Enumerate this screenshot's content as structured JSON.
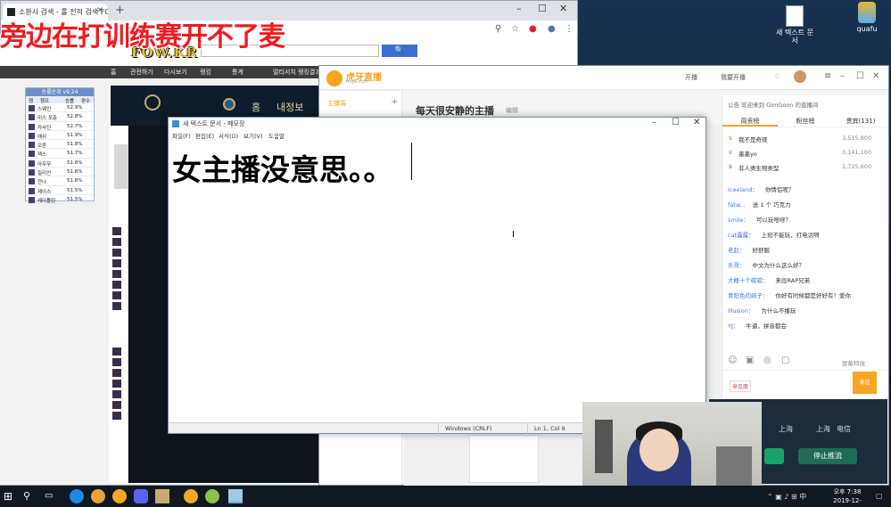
{
  "caption": "旁边在打训练赛开不了麦",
  "desktop": {
    "icons": [
      {
        "label": "새 텍스트 문\n서",
        "icon": "text-file-icon"
      },
      {
        "label": "quafu",
        "icon": "app-icon"
      }
    ]
  },
  "chrome": {
    "tab_title": "소환사 검색 - 롤 전적 검색 FOW.KR",
    "site_logo": "FOW.KR",
    "search_button": "🔍",
    "nav": [
      "홈",
      "관전하기",
      "다시보기",
      "랭킹",
      "통계",
      "멀티서치",
      "랭킹결과"
    ],
    "ranking": {
      "header": "승률순위 v9.24",
      "columns": [
        "챔",
        "챔프",
        "승률",
        "판수"
      ],
      "rows": [
        {
          "name": "스웨인",
          "pct": "52.9%"
        },
        {
          "name": "미스 포츈",
          "pct": "52.8%"
        },
        {
          "name": "카사딘",
          "pct": "52.7%"
        },
        {
          "name": "애쉬",
          "pct": "51.9%"
        },
        {
          "name": "오른",
          "pct": "51.8%"
        },
        {
          "name": "잭스",
          "pct": "51.7%"
        },
        {
          "name": "아무무",
          "pct": "51.6%"
        },
        {
          "name": "질리언",
          "pct": "51.6%"
        },
        {
          "name": "잔나",
          "pct": "51.6%"
        },
        {
          "name": "제이스",
          "pct": "51.5%"
        },
        {
          "name": "케이틀린",
          "pct": "51.5%"
        }
      ]
    }
  },
  "lol": {
    "home": "홈",
    "collection": "내정보"
  },
  "huya": {
    "brand": "虎牙直播",
    "brand_sub": "huya.com",
    "top_buttons": [
      "开播",
      "我要开播"
    ],
    "sidebar_label": "主播端",
    "room_title": "每天很安静的主播",
    "edit_label": "编辑",
    "chat": {
      "notice": "公告  欢迎来到 GimGoon 的直播间",
      "tabs": [
        "周贡榜",
        "粉丝榜",
        "贵宾(131)"
      ],
      "fans": [
        {
          "name": "我不是奇观",
          "amount": "3,515,800"
        },
        {
          "name": "墨墨yo",
          "amount": "3,141,100"
        },
        {
          "name": "非人类生物类型",
          "amount": "1,725,600"
        }
      ],
      "messages": [
        {
          "user": "iceeland：",
          "text": "你情侣呢？"
        },
        {
          "user": "fatw...",
          "text": "送 1 个 巧克力"
        },
        {
          "user": "smile：",
          "text": "可以玩啥呀？"
        },
        {
          "user": "cat露露：",
          "text": "上班不能玩，打电话啊"
        },
        {
          "user": "老赵：",
          "text": "好舒服"
        },
        {
          "user": "乐哥：",
          "text": "中文为什么这么好？"
        },
        {
          "user": "大概十个碳碳：",
          "text": "来段RAP兄弟"
        },
        {
          "user": "青阳色的妹子：",
          "text": "你好有时候都是好好有！爱你"
        },
        {
          "user": "illusion：",
          "text": "为什么不播玩"
        },
        {
          "user": "YJ：",
          "text": "牛逼，拼音都会"
        }
      ],
      "report": "屏蔽特效",
      "send": "发送",
      "checkin": "来见面"
    },
    "stream_controls": {
      "loc1": "上海",
      "loc2": "上海",
      "loc3": "电信",
      "stop_button": "停止推流"
    }
  },
  "notepad": {
    "title": "새 텍스트 문서 - 메모장",
    "menu": [
      "파일(F)",
      "편집(E)",
      "서식(O)",
      "보기(V)",
      "도움말"
    ],
    "content": "女主播没意思。。",
    "status_encoding": "Windows (CRLF)",
    "status_position": "Ln 1, Col 9"
  },
  "taskbar": {
    "clock_time": "오후 7:38",
    "clock_date": "2019-12-24"
  }
}
